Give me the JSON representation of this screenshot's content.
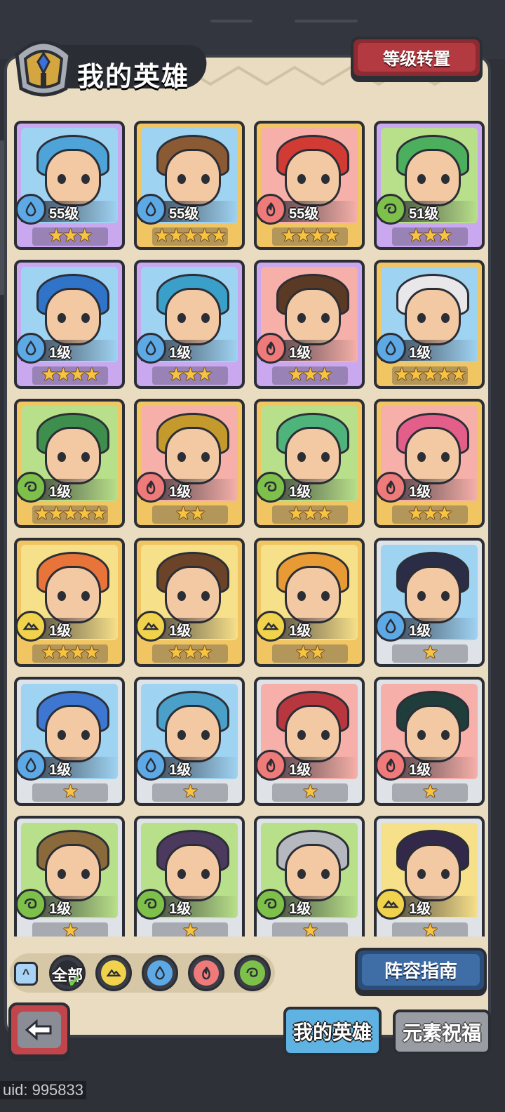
{
  "header": {
    "title": "我的英雄",
    "level_transfer_label": "等级转置"
  },
  "colors": {
    "panel": "#e9dcc1",
    "card_purple": "#c9a8f0",
    "card_gold": "#f1c561",
    "card_silver": "#dfe3e8",
    "water": "#5da9e6",
    "fire": "#ef7a7a",
    "wind": "#7ec14a",
    "earth": "#f0d24c"
  },
  "heroes": [
    {
      "level": "55级",
      "stars": "★★★",
      "element": "water",
      "rarity": "purple"
    },
    {
      "level": "55级",
      "stars": "★★★★★",
      "element": "water",
      "rarity": "gold"
    },
    {
      "level": "55级",
      "stars": "★★★★",
      "element": "fire",
      "rarity": "gold"
    },
    {
      "level": "51级",
      "stars": "★★★",
      "element": "wind",
      "rarity": "purple"
    },
    {
      "level": "1级",
      "stars": "★★★★",
      "element": "water",
      "rarity": "purple"
    },
    {
      "level": "1级",
      "stars": "★★★",
      "element": "water",
      "rarity": "purple"
    },
    {
      "level": "1级",
      "stars": "★★★",
      "element": "fire",
      "rarity": "purple"
    },
    {
      "level": "1级",
      "stars": "★★★★★",
      "element": "water",
      "rarity": "gold"
    },
    {
      "level": "1级",
      "stars": "★★★★★",
      "element": "wind",
      "rarity": "gold"
    },
    {
      "level": "1级",
      "stars": "★★",
      "element": "fire",
      "rarity": "gold"
    },
    {
      "level": "1级",
      "stars": "★★★",
      "element": "wind",
      "rarity": "gold"
    },
    {
      "level": "1级",
      "stars": "★★★",
      "element": "fire",
      "rarity": "gold"
    },
    {
      "level": "1级",
      "stars": "★★★★",
      "element": "earth",
      "rarity": "gold"
    },
    {
      "level": "1级",
      "stars": "★★★",
      "element": "earth",
      "rarity": "gold"
    },
    {
      "level": "1级",
      "stars": "★★",
      "element": "earth",
      "rarity": "gold"
    },
    {
      "level": "1级",
      "stars": "★",
      "element": "water",
      "rarity": "silver"
    },
    {
      "level": "1级",
      "stars": "★",
      "element": "water",
      "rarity": "silver"
    },
    {
      "level": "1级",
      "stars": "★",
      "element": "water",
      "rarity": "silver"
    },
    {
      "level": "1级",
      "stars": "★",
      "element": "fire",
      "rarity": "silver"
    },
    {
      "level": "1级",
      "stars": "★",
      "element": "fire",
      "rarity": "silver"
    },
    {
      "level": "1级",
      "stars": "★",
      "element": "wind",
      "rarity": "silver"
    },
    {
      "level": "1级",
      "stars": "★",
      "element": "wind",
      "rarity": "silver"
    },
    {
      "level": "1级",
      "stars": "★",
      "element": "wind",
      "rarity": "silver"
    },
    {
      "level": "1级",
      "stars": "★",
      "element": "earth",
      "rarity": "silver"
    }
  ],
  "filters": {
    "all_label": "全部",
    "selected": "全部",
    "elements": [
      "earth",
      "water",
      "fire",
      "wind"
    ]
  },
  "lineup_guide_label": "阵容指南",
  "tabs": {
    "my_heroes": "我的英雄",
    "element_blessing": "元素祝福"
  },
  "uid_text": "uid: 995833"
}
